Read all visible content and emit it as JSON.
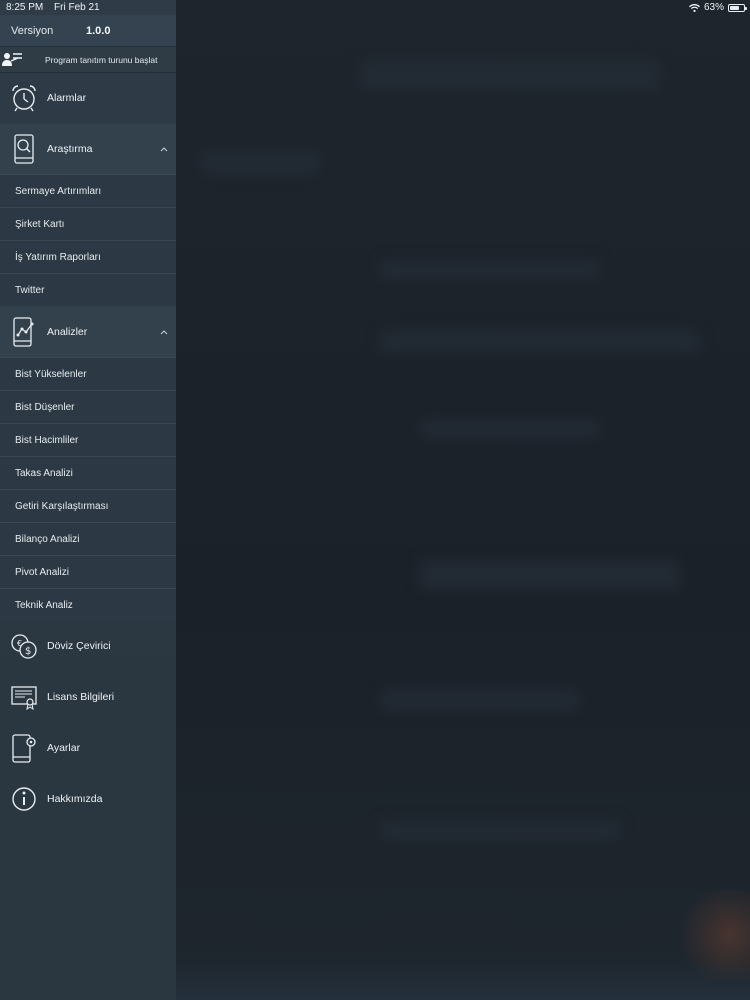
{
  "status_bar": {
    "time": "8:25 PM",
    "date": "Fri Feb 21",
    "battery_percent": "63%",
    "battery_level": 0.63
  },
  "sidebar": {
    "version_label": "Versiyon",
    "version_value": "1.0.0",
    "tour_label": "Program tanıtım turunu başlat",
    "alarms": {
      "label": "Alarmlar",
      "icon": "alarm-clock-icon"
    },
    "research": {
      "label": "Araştırma",
      "icon": "search-phone-icon",
      "expanded": true,
      "items": [
        "Sermaye Artırımları",
        "Şirket Kartı",
        "İş Yatırım Raporları",
        "Twitter"
      ]
    },
    "analyses": {
      "label": "Analizler",
      "icon": "analysis-phone-icon",
      "expanded": true,
      "items": [
        "Bist Yükselenler",
        "Bist Düşenler",
        "Bist Hacimliler",
        "Takas Analizi",
        "Getiri Karşılaştırması",
        "Bilanço Analizi",
        "Pivot Analizi",
        "Teknik Analiz"
      ]
    },
    "currency": {
      "label": "Döviz Çevirici",
      "icon": "currency-exchange-icon"
    },
    "license": {
      "label": "Lisans Bilgileri",
      "icon": "certificate-icon"
    },
    "settings": {
      "label": "Ayarlar",
      "icon": "settings-phone-icon"
    },
    "about": {
      "label": "Hakkımızda",
      "icon": "info-icon"
    }
  }
}
